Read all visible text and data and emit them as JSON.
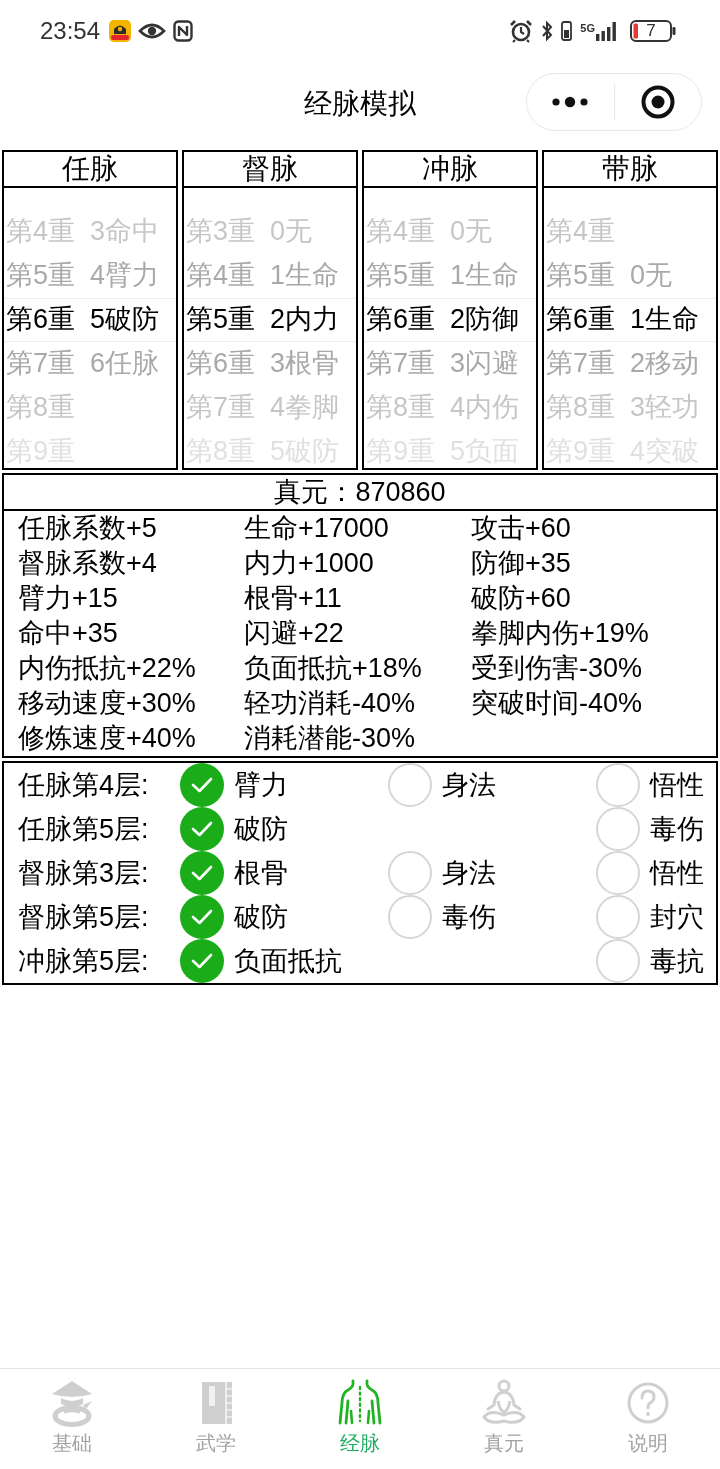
{
  "status_bar": {
    "time": "23:54",
    "network": "5G",
    "battery": "7"
  },
  "nav_bar": {
    "title": "经脉模拟"
  },
  "meridians": [
    {
      "name": "任脉",
      "rows": [
        {
          "level": "第4重",
          "attribute": "3命中",
          "selected": false
        },
        {
          "level": "第5重",
          "attribute": "4臂力",
          "selected": false
        },
        {
          "level": "第6重",
          "attribute": "5破防",
          "selected": true
        },
        {
          "level": "第7重",
          "attribute": "6任脉",
          "selected": false
        },
        {
          "level": "第8重",
          "selected": false
        },
        {
          "level": "第9重",
          "selected": false
        }
      ]
    },
    {
      "name": "督脉",
      "rows": [
        {
          "level": "第3重",
          "attribute": "0无",
          "selected": false
        },
        {
          "level": "第4重",
          "attribute": "1生命",
          "selected": false
        },
        {
          "level": "第5重",
          "attribute": "2内力",
          "selected": true
        },
        {
          "level": "第6重",
          "attribute": "3根骨",
          "selected": false
        },
        {
          "level": "第7重",
          "attribute": "4拳脚",
          "selected": false
        },
        {
          "level": "第8重",
          "attribute": "5破防",
          "selected": false
        }
      ]
    },
    {
      "name": "冲脉",
      "rows": [
        {
          "level": "第4重",
          "attribute": "0无",
          "selected": false
        },
        {
          "level": "第5重",
          "attribute": "1生命",
          "selected": false
        },
        {
          "level": "第6重",
          "attribute": "2防御",
          "selected": true
        },
        {
          "level": "第7重",
          "attribute": "3闪避",
          "selected": false
        },
        {
          "level": "第8重",
          "attribute": "4内伤",
          "selected": false
        },
        {
          "level": "第9重",
          "attribute": "5负面",
          "selected": false
        }
      ]
    },
    {
      "name": "带脉",
      "rows": [
        {
          "level": "第4重",
          "selected": false
        },
        {
          "level": "第5重",
          "attribute": "0无",
          "selected": false
        },
        {
          "level": "第6重",
          "attribute": "1生命",
          "selected": true
        },
        {
          "level": "第7重",
          "attribute": "2移动",
          "selected": false
        },
        {
          "level": "第8重",
          "attribute": "3轻功",
          "selected": false
        },
        {
          "level": "第9重",
          "attribute": "4突破",
          "selected": false
        }
      ]
    }
  ],
  "summary": {
    "title": "真元：870860",
    "bonuses": [
      "任脉系数+5",
      "生命+17000",
      "攻击+60",
      "督脉系数+4",
      "内力+1000",
      "防御+35",
      "臂力+15",
      "根骨+11",
      "破防+60",
      "命中+35",
      "闪避+22",
      "拳脚内伤+19%",
      "内伤抵抗+22%",
      "负面抵抗+18%",
      "受到伤害-30%",
      "移动速度+30%",
      "轻功消耗-40%",
      "突破时间-40%",
      "修炼速度+40%",
      "消耗潜能-30%"
    ]
  },
  "acupoints": [
    {
      "label": "任脉第4层:",
      "options": [
        {
          "label": "臂力",
          "checked": true
        },
        {
          "label": "身法",
          "checked": false
        },
        {
          "label": "悟性",
          "checked": false
        }
      ]
    },
    {
      "label": "任脉第5层:",
      "options": [
        {
          "label": "破防",
          "checked": true
        },
        {
          "label": "毒伤",
          "checked": false
        }
      ]
    },
    {
      "label": "督脉第3层:",
      "options": [
        {
          "label": "根骨",
          "checked": true
        },
        {
          "label": "身法",
          "checked": false
        },
        {
          "label": "悟性",
          "checked": false
        }
      ]
    },
    {
      "label": "督脉第5层:",
      "options": [
        {
          "label": "破防",
          "checked": true
        },
        {
          "label": "毒伤",
          "checked": false
        },
        {
          "label": "封穴",
          "checked": false
        }
      ]
    },
    {
      "label": "冲脉第5层:",
      "options": [
        {
          "label": "负面抵抗",
          "checked": true
        },
        {
          "label": "毒抗",
          "checked": false
        }
      ]
    }
  ],
  "tab_bar": [
    {
      "label": "基础",
      "selected": false
    },
    {
      "label": "武学",
      "selected": false
    },
    {
      "label": "经脉",
      "selected": true
    },
    {
      "label": "真元",
      "selected": false
    },
    {
      "label": "说明",
      "selected": false
    }
  ]
}
